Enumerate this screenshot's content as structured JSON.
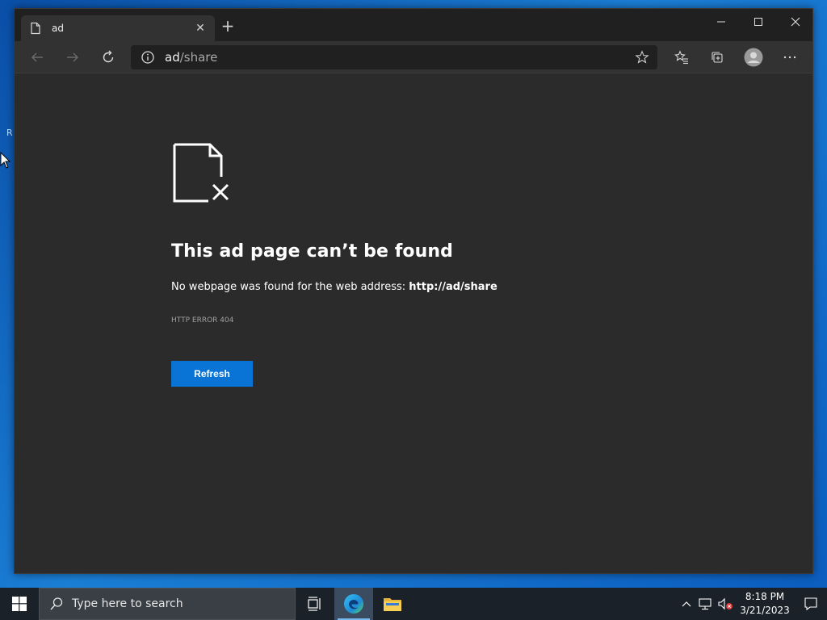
{
  "desktop": {
    "icon_label": "R"
  },
  "browser": {
    "tab": {
      "title": "ad",
      "close_glyph": "✕"
    },
    "new_tab_glyph": "+",
    "address": {
      "host": "ad",
      "path": "/share"
    },
    "icons": [
      "back-icon",
      "forward-icon",
      "refresh-icon",
      "info-icon",
      "favorite-star-icon",
      "favorites-icon",
      "collections-icon",
      "profile-icon",
      "more-icon"
    ]
  },
  "error_page": {
    "title": "This ad page can’t be found",
    "description_prefix": "No webpage was found for the web address: ",
    "description_url": "http://ad/share",
    "error_code": "HTTP ERROR 404",
    "refresh_label": "Refresh",
    "accent_color": "#0a74d6"
  },
  "taskbar": {
    "search_placeholder": "Type here to search",
    "time": "8:18 PM",
    "date": "3/21/2023"
  }
}
